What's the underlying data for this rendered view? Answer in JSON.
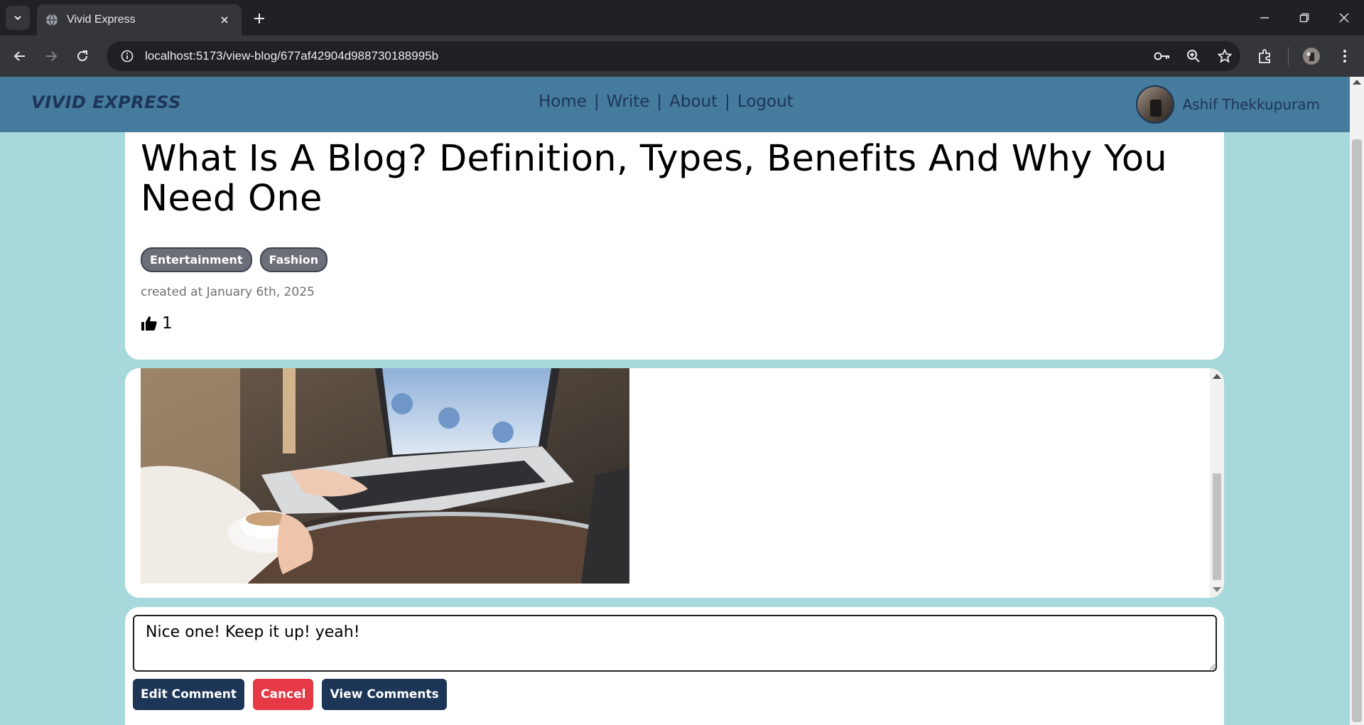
{
  "browser": {
    "tab_title": "Vivid Express",
    "url": "localhost:5173/view-blog/677af42904d988730188995b"
  },
  "site": {
    "brand": "VIVID EXPRESS",
    "nav": [
      "Home",
      "Write",
      "About",
      "Logout"
    ],
    "nav_separator": "|",
    "user_name": "Ashif Thekkupuram"
  },
  "post": {
    "title": "What Is A Blog? Definition, Types, Benefits And Why You Need One",
    "tags": [
      "Entertainment",
      "Fashion"
    ],
    "created": "created at January 6th, 2025",
    "likes": "1"
  },
  "comment": {
    "value": "Nice one! Keep it up! yeah!",
    "edit_label": "Edit Comment",
    "cancel_label": "Cancel",
    "view_label": "View Comments"
  },
  "colors": {
    "header_bg": "#457b9d",
    "page_bg": "#a7d8dc",
    "navy": "#1d3557",
    "red": "#e63946"
  }
}
